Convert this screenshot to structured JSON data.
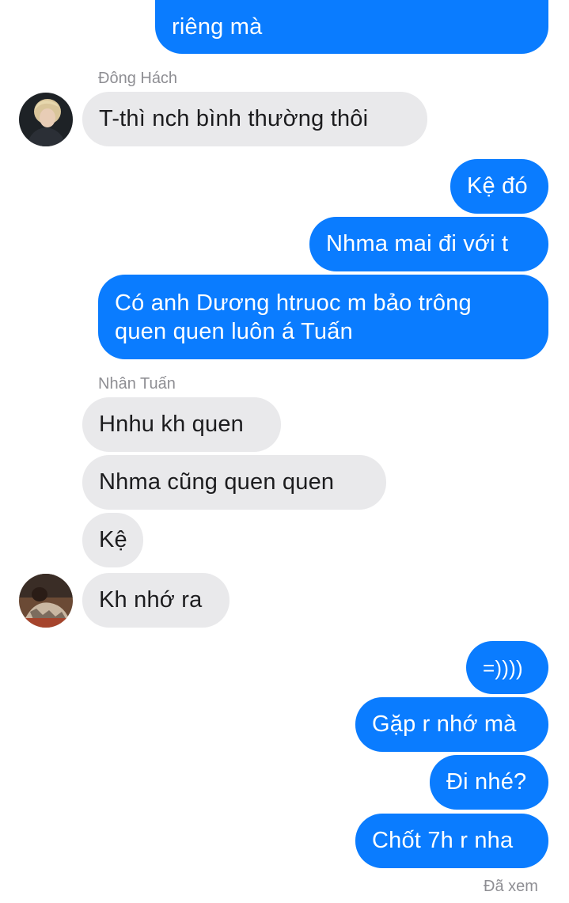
{
  "conversation": {
    "messages": [
      {
        "side": "sent",
        "text": "riêng mà"
      },
      {
        "side": "recv",
        "text": "T-thì nch bình thường thôi"
      },
      {
        "side": "sent",
        "text": "Kệ đó"
      },
      {
        "side": "sent",
        "text": "Nhma mai đi với t"
      },
      {
        "side": "sent",
        "line1": "Có anh Dương htruoc m bảo trông",
        "line2": "quen quen luôn á Tuấn"
      },
      {
        "side": "recv",
        "text": "Hnhu kh quen"
      },
      {
        "side": "recv",
        "text": "Nhma cũng quen quen"
      },
      {
        "side": "recv",
        "text": "Kệ"
      },
      {
        "side": "recv",
        "text": "Kh nhớ ra"
      },
      {
        "side": "sent",
        "text": "=))))"
      },
      {
        "side": "sent",
        "text": "Gặp r nhớ mà"
      },
      {
        "side": "sent",
        "text": "Đi nhé?"
      },
      {
        "side": "sent",
        "text": "Chốt 7h r nha"
      }
    ],
    "senders": {
      "dong_hach": "Đông Hách",
      "nhan_tuan": "Nhân Tuấn"
    },
    "read_receipt": "Đã xem"
  },
  "colors": {
    "sent_bubble": "#0a7cff",
    "recv_bubble": "#e9e9eb",
    "meta_text": "#8e8e93"
  }
}
